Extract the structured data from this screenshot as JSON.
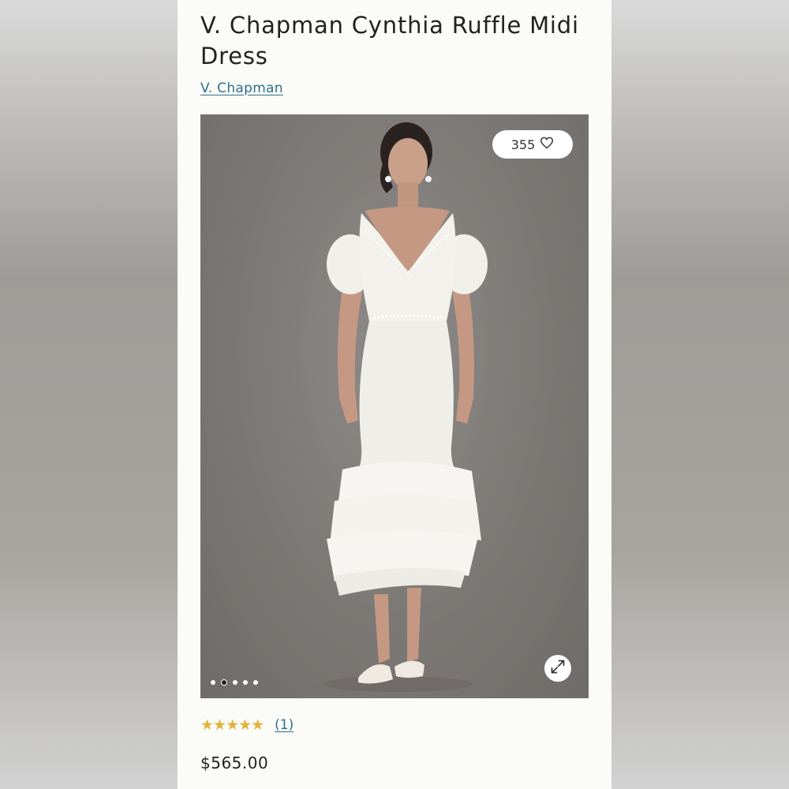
{
  "product": {
    "title": "V. Chapman Cynthia Ruffle Midi Dress",
    "brand": "V. Chapman",
    "likes": "355",
    "rating_stars": "★★★★★",
    "review_count": "(1)",
    "price": "$565.00"
  },
  "gallery": {
    "image_count": 5,
    "active_index": 1
  },
  "icons": {
    "like": "heart-icon",
    "expand": "expand-icon"
  },
  "colors": {
    "link": "#2f6f8c",
    "stars": "#e2b33c",
    "image_background": "#7f7b78"
  }
}
